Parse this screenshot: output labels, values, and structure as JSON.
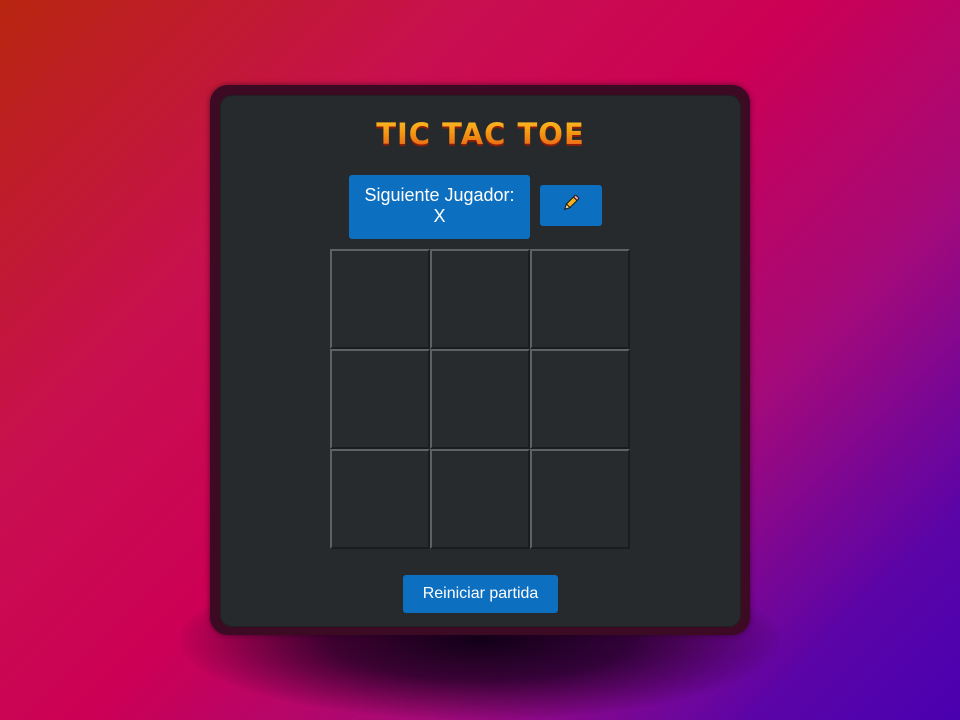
{
  "game": {
    "title": "TIC TAC TOE",
    "status_label": "Siguiente Jugador:",
    "current_player": "X",
    "edit_icon": "pencil-icon",
    "reset_label": "Reiniciar partida",
    "board": [
      "",
      "",
      "",
      "",
      "",
      "",
      "",
      "",
      ""
    ]
  },
  "colors": {
    "accent_blue": "#0d6fc0",
    "panel_bg": "#272a2c",
    "title_orange": "#f39a12"
  }
}
